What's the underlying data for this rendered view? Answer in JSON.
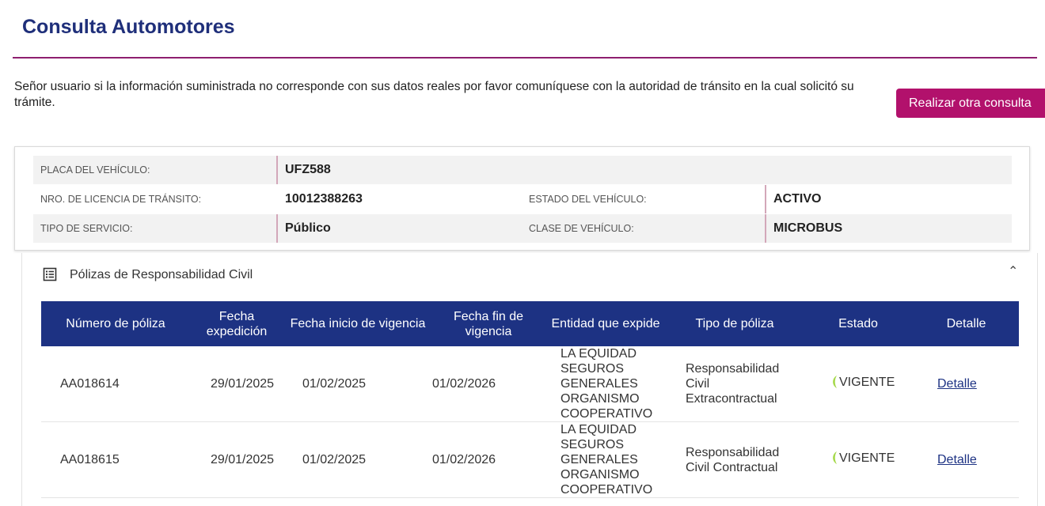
{
  "page": {
    "title": "Consulta Automotores",
    "notice": "Señor usuario si la información suministrada no corresponde con sus datos reales por favor comuníquese con la autoridad de tránsito en la cual solicitó su trámite.",
    "button_label": "Realizar otra consulta"
  },
  "vehicle": {
    "placa_label": "PLACA DEL VEHÍCULO:",
    "placa": "UFZ588",
    "licencia_label": "NRO. DE LICENCIA DE TRÁNSITO:",
    "licencia": "10012388263",
    "estado_label": "ESTADO DEL VEHÍCULO:",
    "estado": "ACTIVO",
    "servicio_label": "TIPO DE SERVICIO:",
    "servicio": "Público",
    "clase_label": "CLASE DE VEHÍCULO:",
    "clase": "MICROBUS"
  },
  "polizas": {
    "section_title": "Pólizas de Responsabilidad Civil",
    "section_icon": "list-document-icon",
    "collapse_icon": "chevron-up-icon",
    "status_icon": "leaf-icon",
    "status_color": "#a6d94c",
    "header_color": "#1d3283",
    "columns": [
      "Número de póliza",
      "Fecha expedición",
      "Fecha inicio de vigencia",
      "Fecha fin de vigencia",
      "Entidad que expide",
      "Tipo de póliza",
      "Estado",
      "Detalle"
    ],
    "rows": [
      {
        "numero": "AA018614",
        "expedicion": "29/01/2025",
        "inicio": "01/02/2025",
        "fin": "01/02/2026",
        "entidad": "LA EQUIDAD SEGUROS GENERALES ORGANISMO COOPERATIVO",
        "tipo": "Responsabilidad Civil Extracontractual",
        "estado": "VIGENTE",
        "detalle": "Detalle"
      },
      {
        "numero": "AA018615",
        "expedicion": "29/01/2025",
        "inicio": "01/02/2025",
        "fin": "01/02/2026",
        "entidad": "LA EQUIDAD SEGUROS GENERALES ORGANISMO COOPERATIVO",
        "tipo": "Responsabilidad Civil Contractual",
        "estado": "VIGENTE",
        "detalle": "Detalle"
      }
    ]
  }
}
